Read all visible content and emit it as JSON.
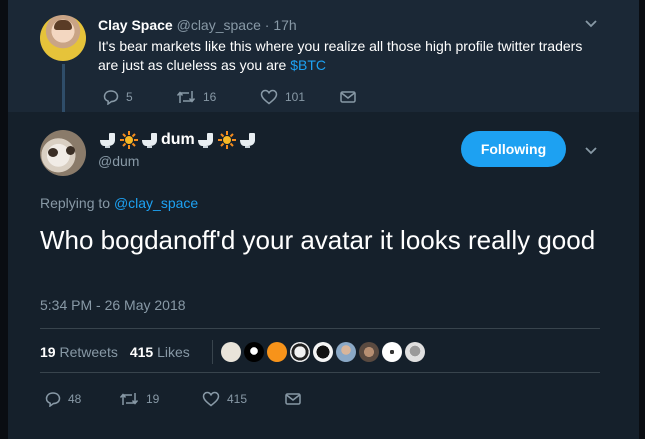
{
  "parent_tweet": {
    "name": "Clay Space",
    "handle": "@clay_space",
    "separator": "·",
    "time": "17h",
    "text_before": "It's bear markets like this where you realize all those high profile twitter traders are just as clueless as you are ",
    "cashtag": "$BTC",
    "replies": "5",
    "retweets": "16",
    "likes": "101"
  },
  "main_tweet": {
    "name": "dum",
    "handle": "@dum",
    "follow_label": "Following",
    "replying_prefix": "Replying to",
    "replying_to": "@clay_space",
    "text": "Who bogdanoff'd your avatar it looks really good",
    "timestamp": "5:34 PM - 26 May 2018",
    "retweet_count": "19",
    "retweet_label": "Retweets",
    "like_count": "415",
    "like_label": "Likes",
    "replies": "48",
    "retweets": "19",
    "likes": "415"
  },
  "icons": {
    "reply": "reply-icon",
    "retweet": "retweet-icon",
    "like": "heart-icon",
    "message": "envelope-icon",
    "more": "chevron-down-icon"
  },
  "colors": {
    "accent": "#1da1f2",
    "background": "#15202b",
    "muted": "#8899a6"
  }
}
